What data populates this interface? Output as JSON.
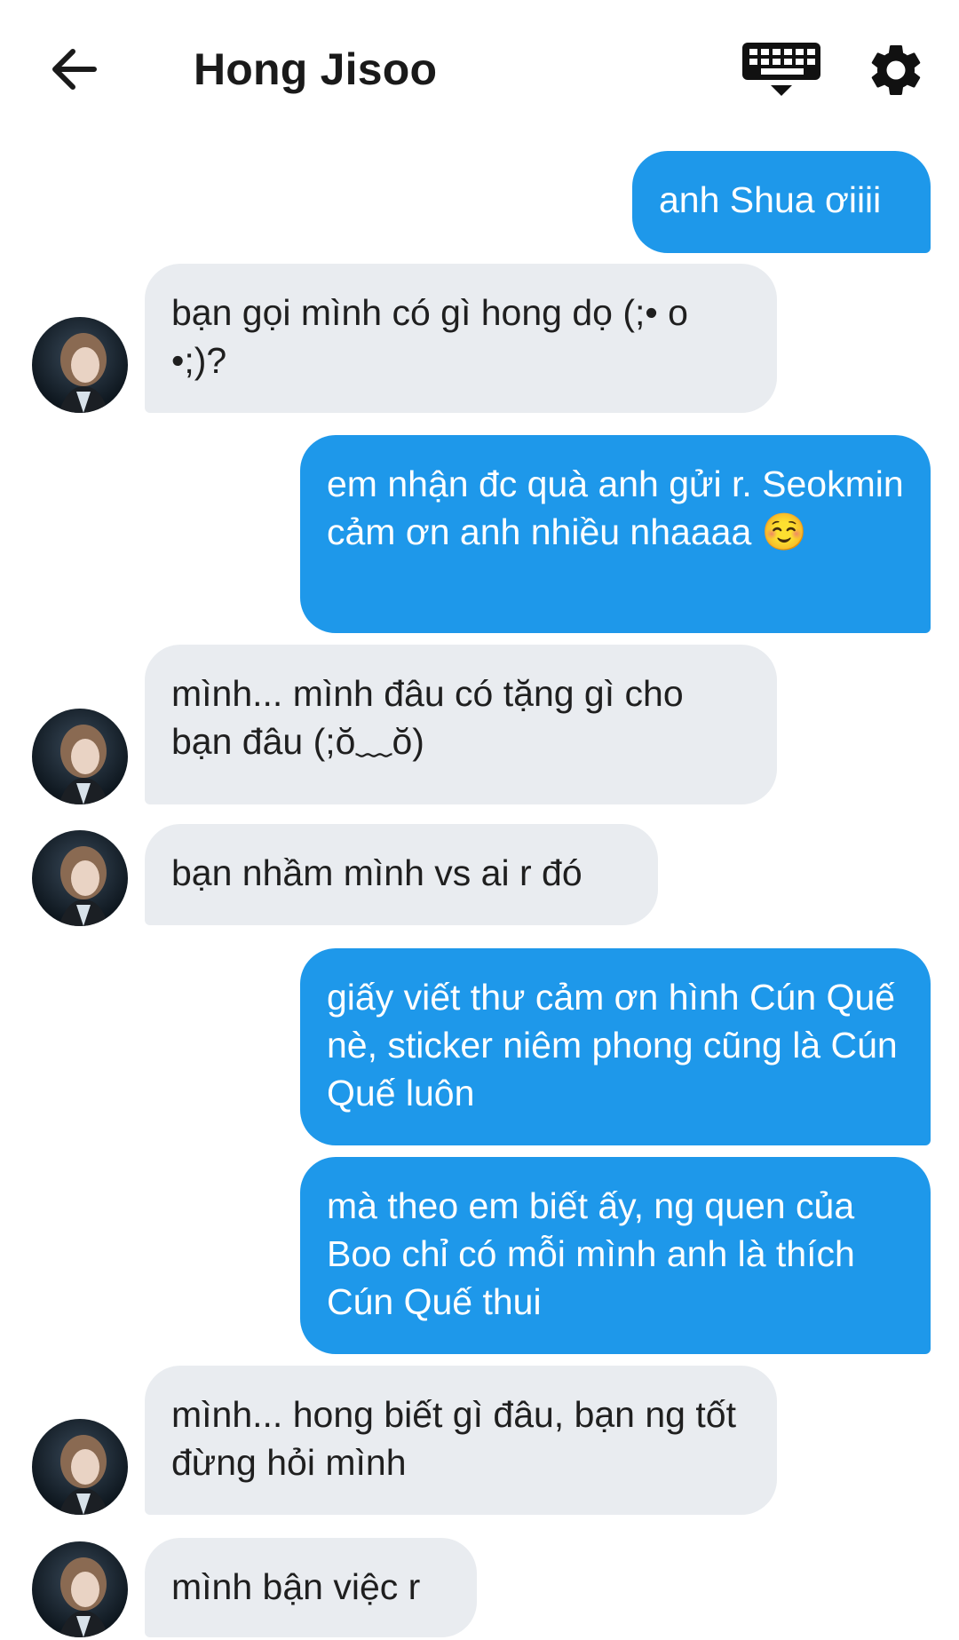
{
  "header": {
    "title": "Hong Jisoo",
    "back_icon": "arrow-left-icon",
    "keyboard_icon": "keyboard-icon",
    "settings_icon": "gear-icon"
  },
  "colors": {
    "outgoing_bubble": "#1e98ea",
    "incoming_bubble": "#e9ecf0"
  },
  "messages": [
    {
      "side": "out",
      "text": "anh Shua ơiiii"
    },
    {
      "side": "in",
      "text": "bạn gọi mình có gì hong dọ (;• o •;)?"
    },
    {
      "side": "out",
      "text": "em nhận đc quà anh gửi r. Seokmin cảm ơn anh nhiều nhaaaa ☺️"
    },
    {
      "side": "in",
      "text": "mình... mình đâu có tặng gì cho bạn đâu (;ŏ﹏ŏ)"
    },
    {
      "side": "in",
      "text": "bạn nhầm mình vs ai r đó"
    },
    {
      "side": "out",
      "text": "giấy viết thư cảm ơn hình Cún Quế nè, sticker niêm phong cũng là Cún Quế luôn"
    },
    {
      "side": "out",
      "text": "mà theo em biết ấy, ng quen của Boo chỉ có mỗi mình anh là thích Cún Quế thui"
    },
    {
      "side": "in",
      "text": "mình... hong biết gì đâu, bạn ng tốt đừng hỏi mình"
    },
    {
      "side": "in",
      "text": "mình bận việc r"
    }
  ]
}
